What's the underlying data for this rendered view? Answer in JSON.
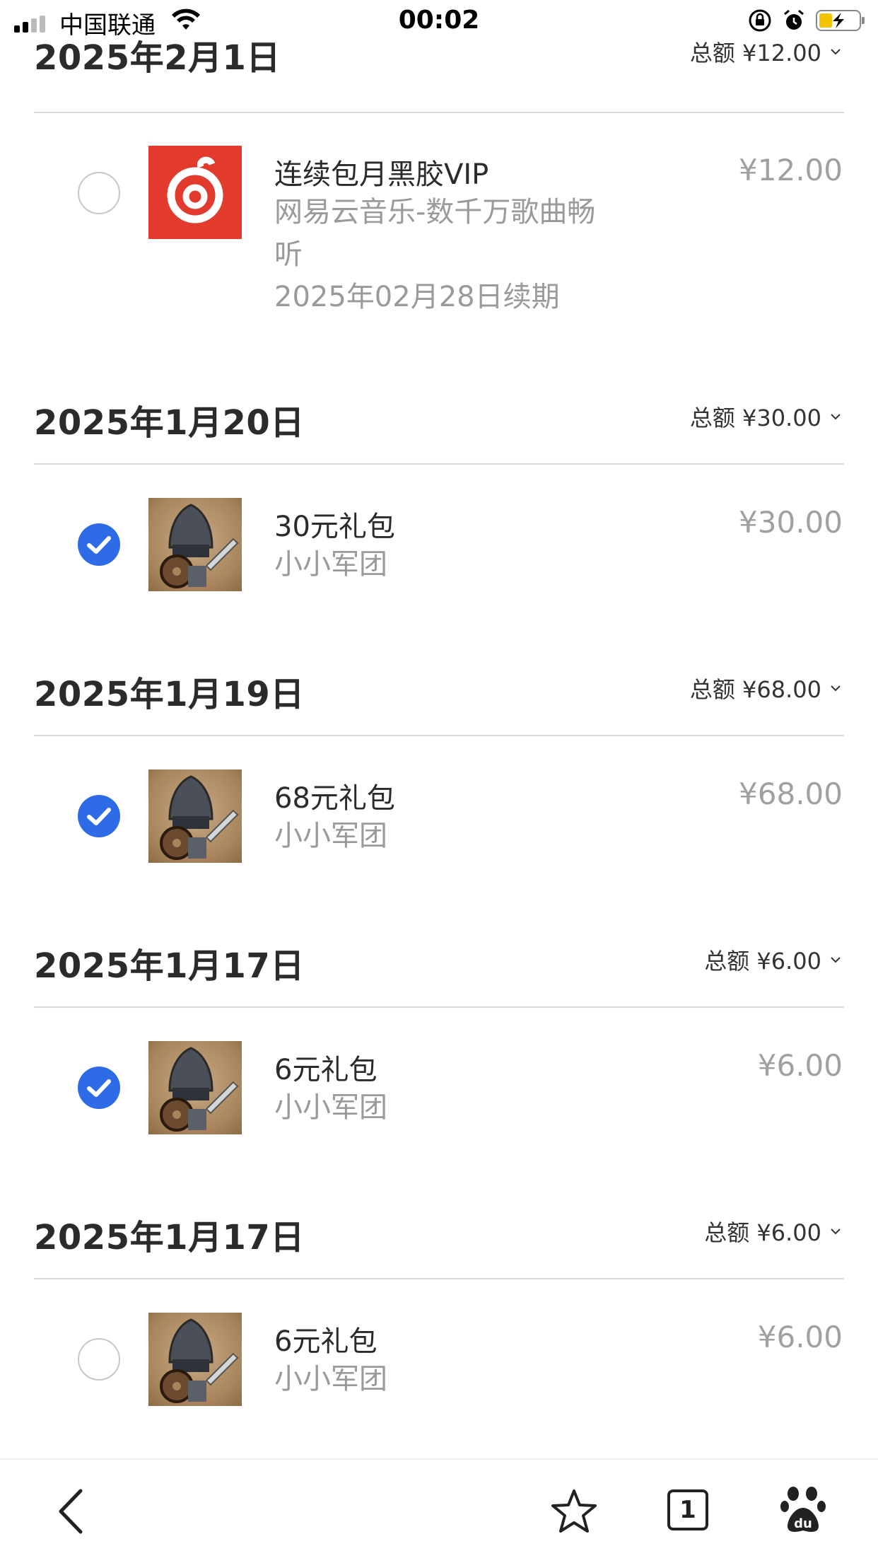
{
  "status_bar": {
    "carrier": "中国联通",
    "time": "00:02"
  },
  "sections": [
    {
      "date": "2025年2月1日",
      "total": "总额 ¥12.00",
      "item": {
        "checked": false,
        "icon": "netease-music-icon",
        "title": "连续包月黑胶VIP",
        "sub1": "网易云音乐-数千万歌曲畅",
        "sub2": "听",
        "sub3": "2025年02月28日续期",
        "price": "¥12.00"
      }
    },
    {
      "date": "2025年1月20日",
      "total": "总额 ¥30.00",
      "item": {
        "checked": true,
        "icon": "knight-game-icon",
        "title": "30元礼包",
        "sub1": "小小军团",
        "price": "¥30.00"
      }
    },
    {
      "date": "2025年1月19日",
      "total": "总额 ¥68.00",
      "item": {
        "checked": true,
        "icon": "knight-game-icon",
        "title": "68元礼包",
        "sub1": "小小军团",
        "price": "¥68.00"
      }
    },
    {
      "date": "2025年1月17日",
      "total": "总额 ¥6.00",
      "item": {
        "checked": true,
        "icon": "knight-game-icon",
        "title": "6元礼包",
        "sub1": "小小军团",
        "price": "¥6.00"
      }
    },
    {
      "date": "2025年1月17日",
      "total": "总额 ¥6.00",
      "item": {
        "checked": false,
        "icon": "knight-game-icon",
        "title": "6元礼包",
        "sub1": "小小军团",
        "price": "¥6.00"
      }
    }
  ],
  "toolbar": {
    "tab_count": "1"
  },
  "colors": {
    "accent": "#2e6be6",
    "netease_red": "#e23a2c",
    "muted_text": "#9a9a9a"
  }
}
